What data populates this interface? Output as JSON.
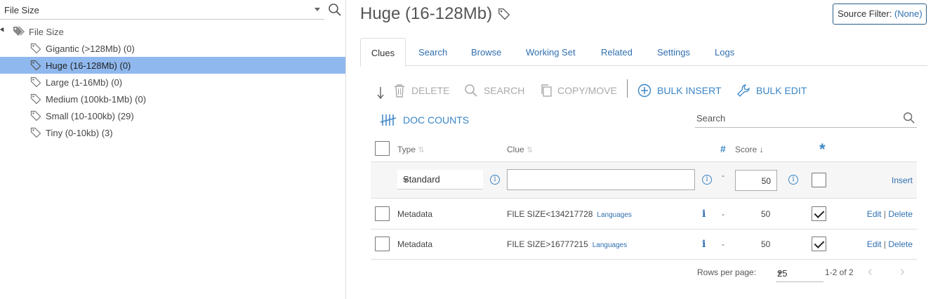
{
  "left_panel": {
    "selector_value": "File Size",
    "tree": {
      "root_label": "File Size",
      "nodes": [
        {
          "label": "Gigantic (>128Mb) (0)"
        },
        {
          "label": "Huge (16-128Mb) (0)",
          "selected": true
        },
        {
          "label": "Large (1-16Mb) (0)"
        },
        {
          "label": "Medium (100kb-1Mb) (0)"
        },
        {
          "label": "Small (10-100kb) (29)"
        },
        {
          "label": "Tiny (0-10kb) (3)"
        }
      ]
    }
  },
  "header": {
    "title": "Huge (16-128Mb)",
    "source_filter_label": "Source Filter:",
    "source_filter_value": "(None)"
  },
  "tabs": [
    "Clues",
    "Search",
    "Browse",
    "Working Set",
    "Related",
    "Settings",
    "Logs"
  ],
  "active_tab": "Clues",
  "toolbar": {
    "delete": "DELETE",
    "search": "SEARCH",
    "copy_move": "COPY/MOVE",
    "bulk_insert": "BULK INSERT",
    "bulk_edit": "BULK EDIT",
    "doc_counts": "DOC COUNTS",
    "search_placeholder": "Search"
  },
  "grid": {
    "headers": {
      "type": "Type",
      "clue": "Clue",
      "hash": "#",
      "score": "Score",
      "star": "*"
    },
    "insert_row": {
      "type_value": "Standard",
      "dash": "-",
      "score_value": "50",
      "insert_label": "Insert"
    },
    "rows": [
      {
        "type": "Metadata",
        "clue": "FILE SIZE<134217728",
        "lang": "Languages",
        "dash": "-",
        "score": "50",
        "checked": true,
        "edit": "Edit",
        "sep": "|",
        "delete": "Delete"
      },
      {
        "type": "Metadata",
        "clue": "FILE SIZE>16777215",
        "lang": "Languages",
        "dash": "-",
        "score": "50",
        "checked": true,
        "edit": "Edit",
        "sep": "|",
        "delete": "Delete"
      }
    ]
  },
  "pager": {
    "rows_per_page_label": "Rows per page:",
    "rows_per_page": "25",
    "range": "1-2 of 2"
  },
  "colors": {
    "accent": "#2f6fb0",
    "selected_row": "#8fb8ee",
    "toolbar_blue": "#3a86c6"
  }
}
